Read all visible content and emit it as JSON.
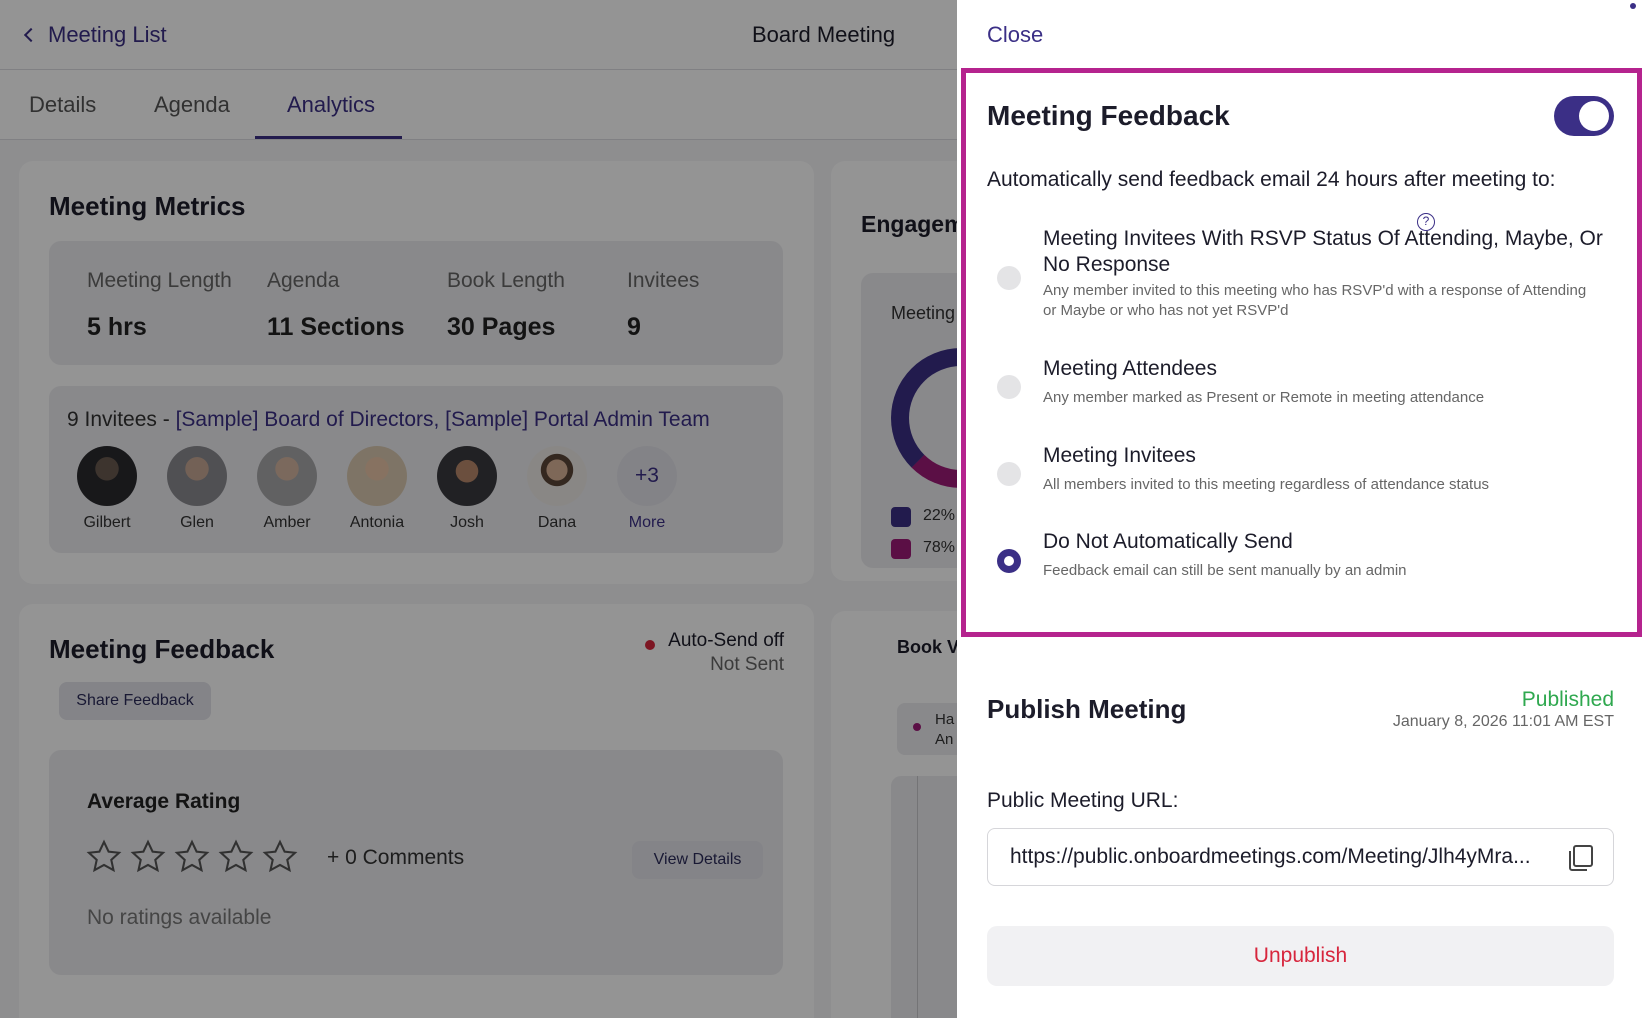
{
  "header": {
    "back_label": "Meeting List",
    "title": "Board Meeting"
  },
  "tabs": [
    {
      "label": "Details"
    },
    {
      "label": "Agenda"
    },
    {
      "label": "Analytics"
    }
  ],
  "metrics": {
    "title": "Meeting Metrics",
    "items": [
      {
        "label": "Meeting Length",
        "value": "5 hrs"
      },
      {
        "label": "Agenda",
        "value": "11 Sections"
      },
      {
        "label": "Book Length",
        "value": "30 Pages"
      },
      {
        "label": "Invitees",
        "value": "9"
      }
    ],
    "invitees_count_text": "9 Invitees - ",
    "invitees_groups": "[Sample] Board of Directors, [Sample] Portal Admin Team",
    "avatars": [
      {
        "name": "Gilbert"
      },
      {
        "name": "Glen"
      },
      {
        "name": "Amber"
      },
      {
        "name": "Antonia"
      },
      {
        "name": "Josh"
      },
      {
        "name": "Dana"
      }
    ],
    "more_count": "+3",
    "more_label": "More"
  },
  "engagement": {
    "title": "Engagem",
    "sub": "Meeting",
    "legend": [
      "22%",
      "78%"
    ]
  },
  "book": {
    "title": "Book V",
    "legend": [
      "Ha",
      "An"
    ]
  },
  "feedback_card": {
    "title": "Meeting Feedback",
    "status": "Auto-Send off",
    "sent_status": "Not Sent",
    "share_button": "Share Feedback",
    "avg_title": "Average Rating",
    "comments": "+ 0 Comments",
    "view_details": "View Details",
    "no_ratings": "No ratings available"
  },
  "panel": {
    "close_label": "Close",
    "feedback": {
      "title": "Meeting Feedback",
      "enabled": true,
      "auto_text": "Automatically send feedback email 24 hours after meeting to:",
      "help_glyph": "?",
      "options": [
        {
          "title": "Meeting Invitees With RSVP Status Of Attending, Maybe, Or No Response",
          "desc": "Any member invited to this meeting who has RSVP'd with a response of Attending or Maybe or who has not yet RSVP'd",
          "selected": false
        },
        {
          "title": "Meeting Attendees",
          "desc": "Any member marked as Present or Remote in meeting attendance",
          "selected": false
        },
        {
          "title": "Meeting Invitees",
          "desc": "All members invited to this meeting regardless of attendance status",
          "selected": false
        },
        {
          "title": "Do Not Automatically Send",
          "desc": "Feedback email can still be sent manually by an admin",
          "selected": true
        }
      ]
    },
    "publish": {
      "title": "Publish Meeting",
      "status": "Published",
      "date": "January 8, 2026 11:01 AM EST",
      "url_label": "Public Meeting URL:",
      "url": "https://public.onboardmeetings.com/Meeting/Jlh4yMra...",
      "unpublish_label": "Unpublish"
    }
  },
  "colors": {
    "accent": "#3b2f86",
    "highlight": "#b5238e",
    "published": "#2fa84f",
    "danger": "#d7263d"
  }
}
